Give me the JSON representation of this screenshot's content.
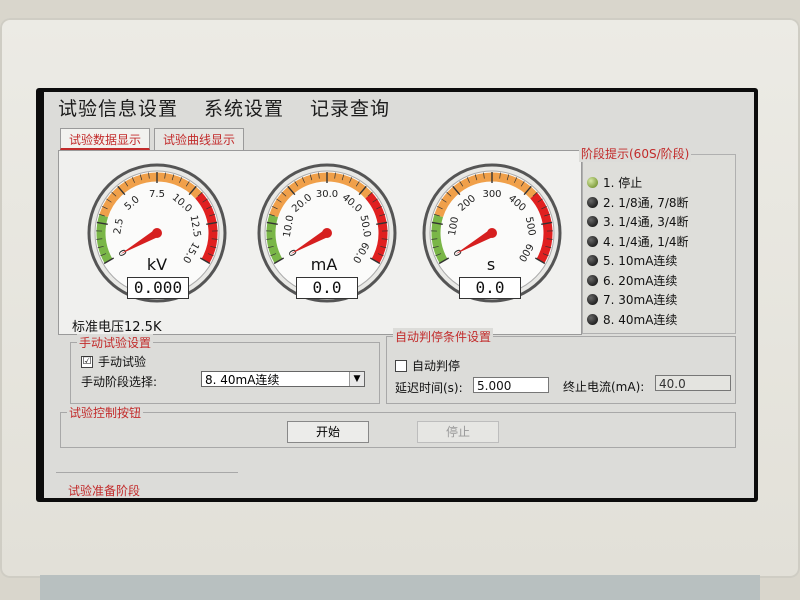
{
  "menu": {
    "items": [
      "试验信息设置",
      "系统设置",
      "记录查询"
    ]
  },
  "tabs": [
    "试验数据显示",
    "试验曲线显示"
  ],
  "gauges": [
    {
      "unit": "kV",
      "readout": "0.000",
      "ticks": [
        "0",
        "2.5",
        "5.0",
        "7.5",
        "10.0",
        "12.5",
        "15.0"
      ],
      "range": [
        0,
        15
      ],
      "value": 0
    },
    {
      "unit": "mA",
      "readout": "0.0",
      "ticks": [
        "0",
        "10.0",
        "20.0",
        "30.0",
        "40.0",
        "50.0",
        "60.0"
      ],
      "range": [
        0,
        60
      ],
      "value": 0
    },
    {
      "unit": "s",
      "readout": "0.0",
      "ticks": [
        "0",
        "100",
        "200",
        "300",
        "400",
        "500",
        "600"
      ],
      "range": [
        0,
        600
      ],
      "value": 0
    }
  ],
  "std_voltage": "标准电压12.5K",
  "stage_panel": {
    "title": "阶段提示(60S/阶段)",
    "items": [
      {
        "label": "1. 停止",
        "active": true
      },
      {
        "label": "2. 1/8通, 7/8断",
        "active": false
      },
      {
        "label": "3. 1/4通, 3/4断",
        "active": false
      },
      {
        "label": "4. 1/4通, 1/4断",
        "active": false
      },
      {
        "label": "5. 10mA连续",
        "active": false
      },
      {
        "label": "6. 20mA连续",
        "active": false
      },
      {
        "label": "7. 30mA连续",
        "active": false
      },
      {
        "label": "8. 40mA连续",
        "active": false
      }
    ]
  },
  "manual": {
    "legend": "手动试验设置",
    "checkbox_label": "手动试验",
    "checked_mark": "☑",
    "stage_select_label": "手动阶段选择:",
    "stage_select_value": "8. 40mA连续",
    "dropdown_arrow": "▼"
  },
  "autostop": {
    "legend": "自动判停条件设置",
    "checkbox_label": "自动判停",
    "delay_label": "延迟时间(s):",
    "delay_value": "5.000",
    "current_label": "终止电流(mA):",
    "current_value": "40.0"
  },
  "control": {
    "legend": "试验控制按钮",
    "start_label": "开始",
    "stop_label": "停止"
  },
  "status": "试验准备阶段",
  "colors": {
    "accent_red": "#c22b2b",
    "gauge_green": "#7ab648",
    "gauge_orange": "#f0a04a",
    "gauge_red": "#e02020",
    "needle": "#d61f1f"
  }
}
